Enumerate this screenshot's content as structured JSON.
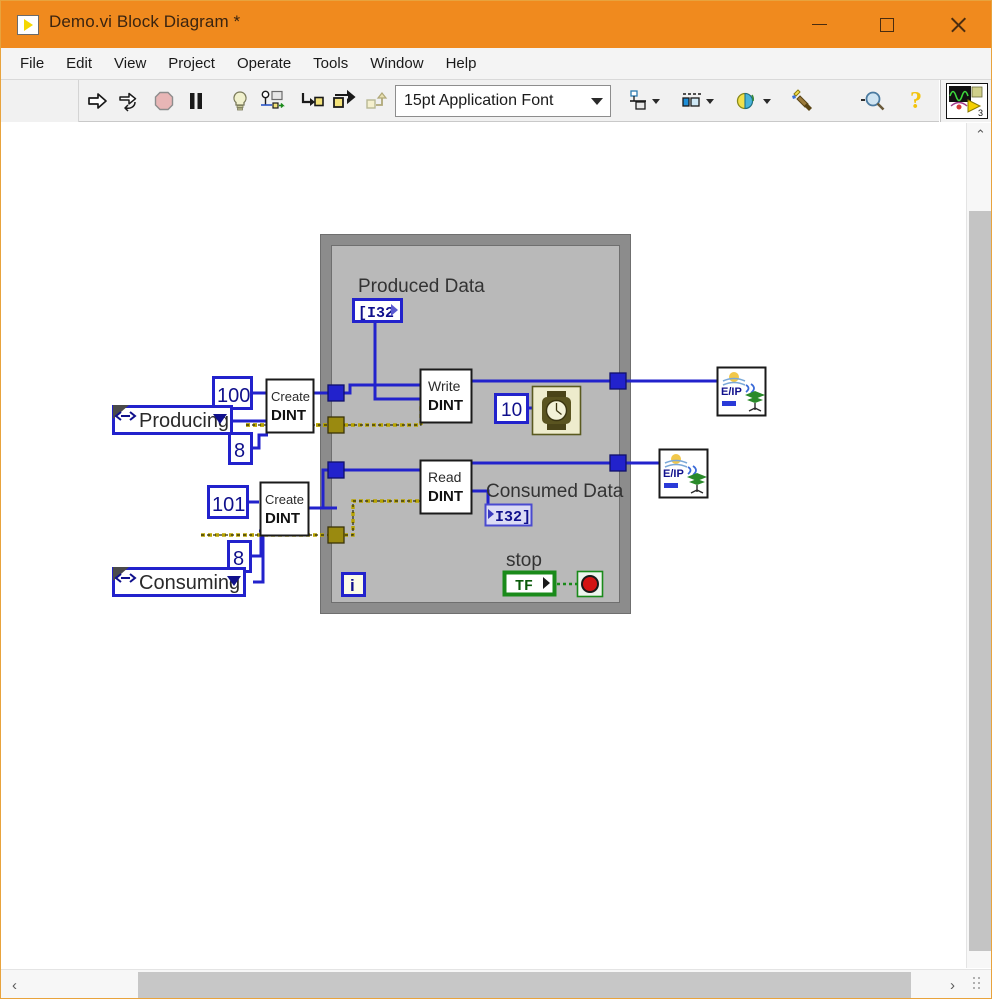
{
  "window": {
    "title": "Demo.vi Block Diagram *",
    "app_icon": "vi-icon",
    "minimize_label": "—",
    "maximize_label": "□",
    "close_label": "✕",
    "titlebar_color": "#f08a1e"
  },
  "menubar": {
    "items": [
      {
        "label": "File"
      },
      {
        "label": "Edit"
      },
      {
        "label": "View"
      },
      {
        "label": "Project"
      },
      {
        "label": "Operate"
      },
      {
        "label": "Tools"
      },
      {
        "label": "Window"
      },
      {
        "label": "Help"
      }
    ]
  },
  "toolbar": {
    "buttons": [
      {
        "name": "run-button",
        "icon": "arrow-right-outline-icon",
        "tooltip": "Run"
      },
      {
        "name": "run-continuously-button",
        "icon": "run-continuously-icon",
        "tooltip": "Run Continuously"
      },
      {
        "name": "abort-button",
        "icon": "abort-stop-icon",
        "tooltip": "Abort Execution"
      },
      {
        "name": "pause-button",
        "icon": "pause-icon",
        "tooltip": "Pause"
      },
      {
        "name": "highlight-execution-button",
        "icon": "lightbulb-icon",
        "tooltip": "Highlight Execution"
      },
      {
        "name": "retain-wire-values-button",
        "icon": "retain-wire-values-icon",
        "tooltip": "Retain Wire Values"
      },
      {
        "name": "step-into-button",
        "icon": "step-into-icon",
        "tooltip": "Step Into"
      },
      {
        "name": "step-over-button",
        "icon": "step-over-icon",
        "tooltip": "Step Over"
      },
      {
        "name": "step-out-button",
        "icon": "step-out-icon",
        "tooltip": "Step Out"
      }
    ],
    "font_selector": {
      "value": "15pt Application Font",
      "arrow": "chevron-down-icon"
    },
    "align_objects": {
      "icon": "align-objects-icon",
      "arrow": "chevron-down-icon"
    },
    "distribute_objects": {
      "icon": "distribute-objects-icon",
      "arrow": "chevron-down-icon"
    },
    "reorder": {
      "icon": "reorder-icon",
      "arrow": "chevron-down-icon"
    },
    "clean_up_diagram": {
      "icon": "clean-up-diagram-icon"
    },
    "search_button": {
      "icon": "search-magnifier-icon"
    },
    "help_button": {
      "icon": "question-mark-icon",
      "label": "?"
    },
    "vi_icon": {
      "name": "vi-icon-pane",
      "badge": "3"
    }
  },
  "diagram": {
    "while_loop": {
      "label": "while-loop",
      "border_color": "#8c8c8c",
      "iteration_terminal": "i"
    },
    "nodes": [
      {
        "name": "produced-data-indicator",
        "label": "Produced Data",
        "terminal_text": "[I32",
        "type": "array-indicator"
      },
      {
        "name": "consumed-data-indicator",
        "label": "Consumed Data",
        "terminal_text": "I32]",
        "type": "array-indicator"
      },
      {
        "name": "write-dint-subvi",
        "line1": "Write",
        "line2": "DINT"
      },
      {
        "name": "read-dint-subvi",
        "line1": "Read",
        "line2": "DINT"
      },
      {
        "name": "create-dint-top-subvi",
        "line1": "Create",
        "line2": "DINT"
      },
      {
        "name": "create-dint-bottom-subvi",
        "line1": "Create",
        "line2": "DINT"
      },
      {
        "name": "wait-ms-function",
        "value": "10",
        "icon": "wristwatch-icon"
      },
      {
        "name": "stop-control",
        "label": "stop",
        "terminal_text": "TF",
        "icon": "stop-sign-icon"
      }
    ],
    "constants": [
      {
        "name": "constant-100",
        "value": "100"
      },
      {
        "name": "constant-8-top",
        "value": "8"
      },
      {
        "name": "constant-101",
        "value": "101"
      },
      {
        "name": "constant-8-bottom",
        "value": "8"
      },
      {
        "name": "constant-10-wait",
        "value": "10"
      }
    ],
    "dropdowns": [
      {
        "name": "producing-control",
        "value": "Producing",
        "arrow": "chevron-down-icon"
      },
      {
        "name": "consuming-control",
        "value": "Consuming",
        "arrow": "chevron-down-icon"
      }
    ],
    "eip_nodes": [
      {
        "name": "eip-node-top",
        "label": "E/IP"
      },
      {
        "name": "eip-node-bottom",
        "label": "E/IP"
      }
    ],
    "colors": {
      "wire_blue": "#2222cc",
      "wire_yellow": "#b8a300",
      "error_wire": "#b8a300",
      "loop_gray": "#8c8c8c",
      "label_text": "#333333",
      "green_bool": "#1a8a1a",
      "stop_red": "#d41414"
    }
  },
  "scrollbars": {
    "vertical": {
      "up_arrow": "⌃",
      "thumb": "vscroll-thumb"
    },
    "horizontal": {
      "left_arrow": "‹",
      "right_arrow": "›",
      "thumb": "hscroll-thumb"
    }
  }
}
